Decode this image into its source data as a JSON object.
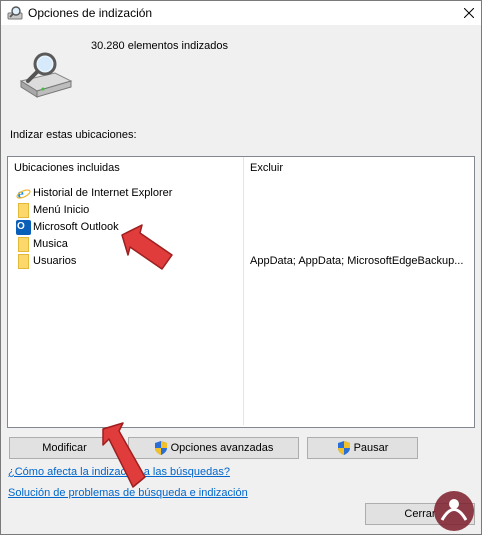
{
  "window": {
    "title": "Opciones de indización"
  },
  "summary": {
    "count_text": "30.280 elementos indizados"
  },
  "section": {
    "label": "Indizar estas ubicaciones:"
  },
  "list": {
    "headers": {
      "included": "Ubicaciones incluidas",
      "exclude": "Excluir"
    },
    "rows": [
      {
        "label": "Historial de Internet Explorer",
        "exclude": "",
        "icon": "internet-explorer-icon"
      },
      {
        "label": "Menú Inicio",
        "exclude": "",
        "icon": "folder-icon"
      },
      {
        "label": "Microsoft Outlook",
        "exclude": "",
        "icon": "outlook-icon"
      },
      {
        "label": "Musica",
        "exclude": "",
        "icon": "folder-icon"
      },
      {
        "label": "Usuarios",
        "exclude": "AppData; AppData; MicrosoftEdgeBackup...",
        "icon": "folder-icon"
      }
    ]
  },
  "buttons": {
    "modify": "Modificar",
    "advanced": "Opciones avanzadas",
    "pause": "Pausar",
    "close": "Cerrar"
  },
  "links": {
    "how_affects": "¿Cómo afecta la indización a las búsquedas?",
    "troubleshoot": "Solución de problemas de búsqueda e indización"
  },
  "colors": {
    "link": "#0066cc",
    "arrow": "#e03c3c",
    "shield_blue": "#2b6fd6",
    "shield_yellow": "#f2c029"
  }
}
